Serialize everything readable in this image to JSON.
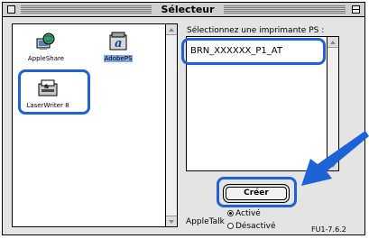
{
  "window": {
    "title": "Sélecteur"
  },
  "drivers": [
    {
      "label": "AppleShare",
      "icon": "appleshare-icon"
    },
    {
      "label": "AdobePS",
      "icon": "adobeps-icon",
      "selected": true
    },
    {
      "label": "LaserWriter 8",
      "icon": "laserwriter-icon"
    }
  ],
  "printer_list": {
    "label": "Sélectionnez une imprimante PS :",
    "items": [
      "BRN_XXXXXX_P1_AT"
    ]
  },
  "create_button": {
    "label": "Créer"
  },
  "appletalk": {
    "label": "AppleTalk",
    "options": [
      {
        "label": "Activé",
        "selected": true
      },
      {
        "label": "Désactivé",
        "selected": false
      }
    ]
  },
  "version": "FU1-7.6.2",
  "colors": {
    "highlight": "#1e63d6",
    "selection": "#7fa8e8",
    "window_bg": "#e4e4e4"
  }
}
